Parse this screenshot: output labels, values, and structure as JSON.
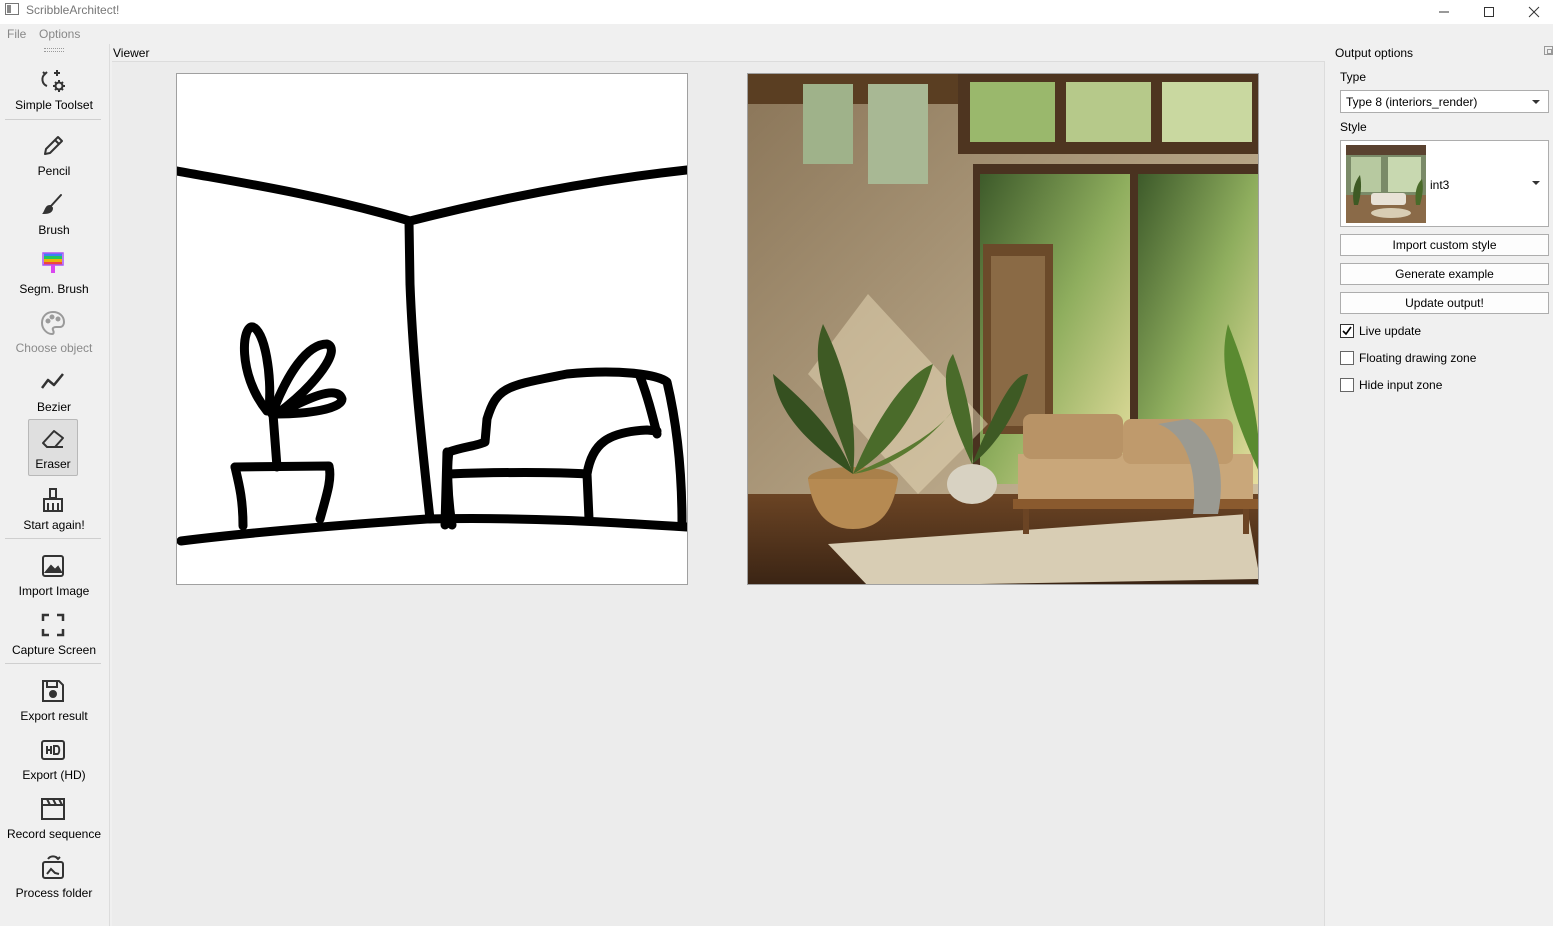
{
  "window": {
    "title": "ScribbleArchitect!",
    "controls": [
      "minimize-icon",
      "maximize-icon",
      "close-icon"
    ]
  },
  "menu": {
    "items": [
      "File",
      "Options"
    ]
  },
  "toolbar": {
    "tools": [
      {
        "label": "Simple Toolset",
        "icon": "toolset-icon"
      },
      {
        "label": "Pencil",
        "icon": "pencil-icon"
      },
      {
        "label": "Brush",
        "icon": "brush-icon"
      },
      {
        "label": "Segm. Brush",
        "icon": "segmentation-brush-icon"
      },
      {
        "label": "Choose object",
        "icon": "palette-icon",
        "disabled": true
      },
      {
        "label": "Bezier",
        "icon": "bezier-icon"
      },
      {
        "label": "Eraser",
        "icon": "eraser-icon",
        "active": true
      },
      {
        "label": "Start again!",
        "icon": "broom-icon"
      },
      {
        "label": "Import Image",
        "icon": "image-icon"
      },
      {
        "label": "Capture Screen",
        "icon": "capture-icon"
      },
      {
        "label": "Export result",
        "icon": "save-icon"
      },
      {
        "label": "Export (HD)",
        "icon": "hd-icon"
      },
      {
        "label": "Record sequence",
        "icon": "clapperboard-icon"
      },
      {
        "label": "Process folder",
        "icon": "folder-process-icon"
      }
    ]
  },
  "viewer": {
    "label": "Viewer"
  },
  "output_options": {
    "title": "Output options",
    "type_label": "Type",
    "type_value": "Type 8 (interiors_render)",
    "style_label": "Style",
    "style_value": "int3",
    "buttons": {
      "import_style": "Import custom style",
      "generate_example": "Generate example",
      "update_output": "Update output!"
    },
    "checkboxes": {
      "live_update": {
        "label": "Live update",
        "checked": true
      },
      "floating_zone": {
        "label": "Floating drawing zone",
        "checked": false
      },
      "hide_input": {
        "label": "Hide input zone",
        "checked": false
      }
    }
  },
  "colors": {
    "accent": "#2b2b2b",
    "background": "#f0f0f0"
  }
}
